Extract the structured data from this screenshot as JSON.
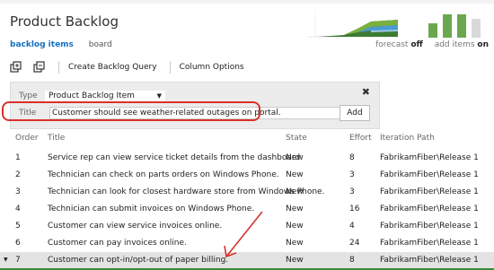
{
  "header": {
    "title": "Product Backlog"
  },
  "subnav": {
    "backlog_items": "backlog items",
    "board": "board"
  },
  "options": {
    "forecast_label": "forecast",
    "forecast_value": "off",
    "add_items_label": "add items",
    "add_items_value": "on"
  },
  "toolbar": {
    "create_query": "Create Backlog Query",
    "column_options": "Column Options"
  },
  "add_panel": {
    "type_label": "Type",
    "type_value": "Product Backlog Item",
    "title_label": "Title",
    "title_value": "Customer should see weather-related outages on portal.",
    "add_button": "Add"
  },
  "grid": {
    "columns": {
      "order": "Order",
      "title": "Title",
      "state": "State",
      "effort": "Effort",
      "path": "Iteration Path"
    },
    "rows": [
      {
        "order": "1",
        "title": "Service rep can view service ticket details from the dashboard",
        "state": "New",
        "effort": "8",
        "path": "FabrikamFiber\\Release 1"
      },
      {
        "order": "2",
        "title": "Technician can check on parts orders on Windows Phone.",
        "state": "New",
        "effort": "3",
        "path": "FabrikamFiber\\Release 1"
      },
      {
        "order": "3",
        "title": "Technician can look for closest hardware store from Windows Phone.",
        "state": "New",
        "effort": "3",
        "path": "FabrikamFiber\\Release 1"
      },
      {
        "order": "4",
        "title": "Technician can submit invoices on Windows Phone.",
        "state": "New",
        "effort": "16",
        "path": "FabrikamFiber\\Release 1"
      },
      {
        "order": "5",
        "title": "Customer can view service invoices online.",
        "state": "New",
        "effort": "4",
        "path": "FabrikamFiber\\Release 1"
      },
      {
        "order": "6",
        "title": "Customer can pay invoices online.",
        "state": "New",
        "effort": "24",
        "path": "FabrikamFiber\\Release 1"
      },
      {
        "order": "7",
        "title": "Customer can opt-in/opt-out of paper billing.",
        "state": "New",
        "effort": "8",
        "path": "FabrikamFiber\\Release 1"
      }
    ]
  },
  "colors": {
    "accent": "#1670c0",
    "highlight": "#d9312b",
    "selected_border": "#3a8a3a",
    "bar_green": "#6aa84f"
  },
  "icons": {
    "expand": "expand-all-icon",
    "collapse": "collapse-all-icon",
    "close": "close-icon",
    "dropdown": "chevron-down-icon",
    "row_caret": "row-caret-icon"
  }
}
